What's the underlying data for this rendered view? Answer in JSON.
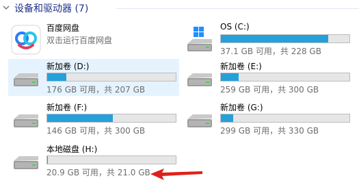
{
  "group": {
    "title": "设备和驱动器 (7)"
  },
  "app": {
    "name": "百度网盘",
    "subtitle": "双击运行百度网盘"
  },
  "drives": [
    {
      "name": "OS (C:)",
      "info": "37.1 GB 可用，共 228 GB",
      "used_fraction": 0.837,
      "icon": "windows-drive-icon"
    },
    {
      "name": "新加卷 (D:)",
      "info": "176 GB 可用，共 207 GB",
      "used_fraction": 0.15,
      "icon": "drive-icon"
    },
    {
      "name": "新加卷 (E:)",
      "info": "259 GB 可用，共 300 GB",
      "used_fraction": 0.137,
      "icon": "drive-icon"
    },
    {
      "name": "新加卷 (F:)",
      "info": "146 GB 可用，共 300 GB",
      "used_fraction": 0.513,
      "icon": "drive-icon"
    },
    {
      "name": "新加卷 (G:)",
      "info": "299 GB 可用，共 330 GB",
      "used_fraction": 0.094,
      "icon": "drive-icon"
    },
    {
      "name": "本地磁盘 (H:)",
      "info": "20.9 GB 可用，共 21.0 GB",
      "used_fraction": 0.005,
      "icon": "drive-icon"
    }
  ],
  "colors": {
    "bar_fill": "#26a0da",
    "title": "#1e3287",
    "selection": "#cce8ff",
    "annotation_arrow": "#e0201a"
  }
}
